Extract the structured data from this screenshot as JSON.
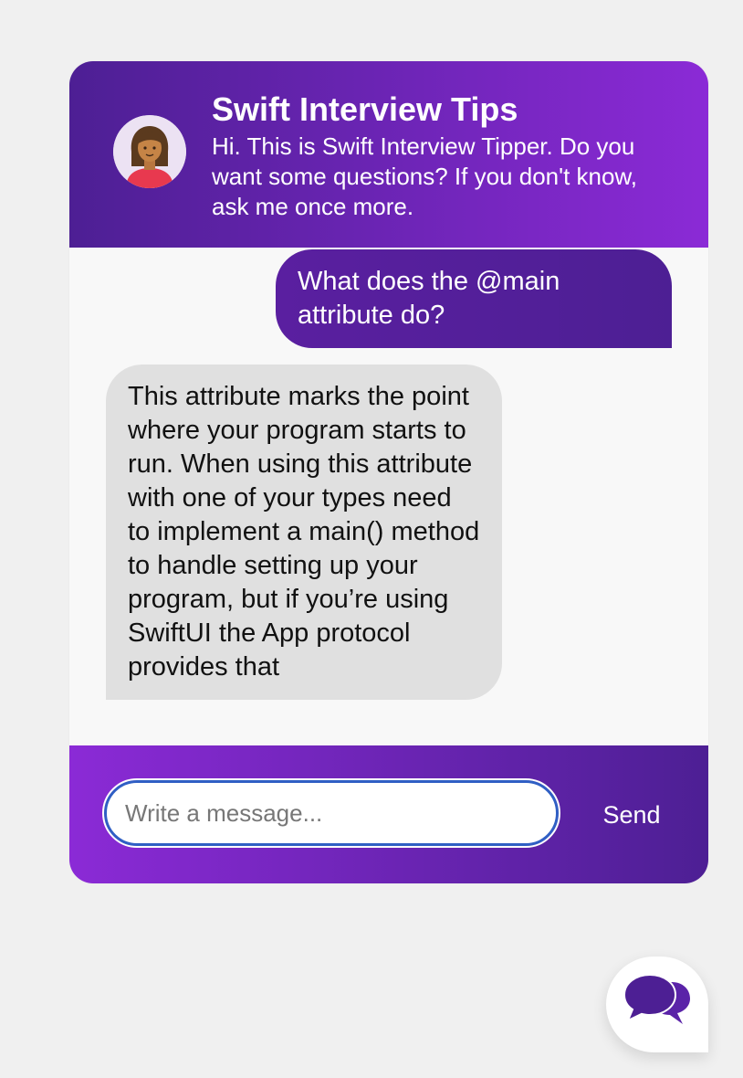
{
  "header": {
    "title": "Swift Interview Tips",
    "description": "Hi. This is Swift Interview Tipper. Do you want some questions? If you don't know, ask me once more."
  },
  "messages": [
    {
      "sender": "user",
      "text": "What does the @main attribute do?"
    },
    {
      "sender": "bot",
      "text": "This attribute marks the point where your program starts to run. When using this attribute with one of your types need to implement a main() method to handle setting up your program, but if you’re using SwiftUI the App protocol provides that"
    }
  ],
  "composer": {
    "placeholder": "Write a message...",
    "value": "",
    "send_label": "Send"
  },
  "colors": {
    "header_gradient_start": "#4d1f94",
    "header_gradient_end": "#8b2ad6",
    "bot_bubble": "#e0e0e0",
    "background": "#f0f0f0"
  },
  "icons": {
    "avatar": "woman-avatar-icon",
    "launcher": "chat-bubbles-icon"
  }
}
